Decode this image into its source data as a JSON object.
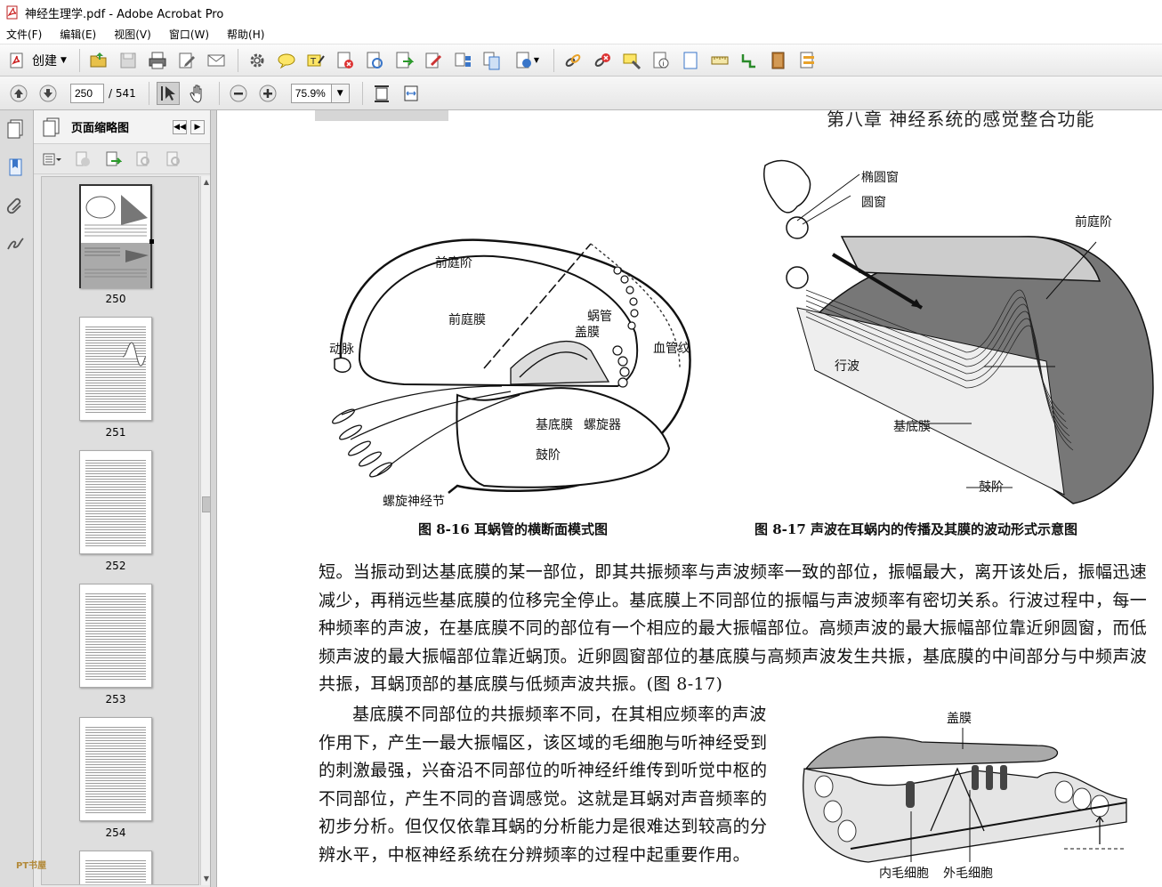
{
  "window": {
    "title": "神经生理学.pdf - Adobe Acrobat Pro"
  },
  "menu": [
    "文件(F)",
    "编辑(E)",
    "视图(V)",
    "窗口(W)",
    "帮助(H)"
  ],
  "toolbar": {
    "create_label": "创建"
  },
  "nav": {
    "page_value": "250",
    "page_total": "/ 541",
    "zoom_value": "75.9%"
  },
  "panel": {
    "title": "页面缩略图"
  },
  "thumbnails": [
    {
      "label": "250"
    },
    {
      "label": "251"
    },
    {
      "label": "252"
    },
    {
      "label": "253"
    },
    {
      "label": "254"
    }
  ],
  "document": {
    "running_header": "第八章  神经系统的感觉整合功能",
    "fig16": {
      "caption": "图 8-16   耳蜗管的横断面模式图",
      "labels": {
        "vestibuli": "前庭阶",
        "vest_membrane": "前庭膜",
        "cochlear_duct": "蜗管",
        "tectorial": "盖膜",
        "artery": "动脉",
        "stria": "血管纹",
        "basilar": "基底膜",
        "organ": "螺旋器",
        "tympani": "鼓阶",
        "ganglion": "螺旋神经节"
      }
    },
    "fig17": {
      "caption": "图 8-17   声波在耳蜗内的传播及其膜的波动形式示意图",
      "labels": {
        "oval": "椭圆窗",
        "round": "圆窗",
        "vestibuli": "前庭阶",
        "wave": "行波",
        "basilar": "基底膜",
        "tympani": "鼓阶"
      }
    },
    "paragraph1": "短。当振动到达基底膜的某一部位，即其共振频率与声波频率一致的部位，振幅最大，离开该处后，振幅迅速减少，再稍远些基底膜的位移完全停止。基底膜上不同部位的振幅与声波频率有密切关系。行波过程中，每一种频率的声波，在基底膜不同的部位有一个相应的最大振幅部位。高频声波的最大振幅部位靠近卵圆窗，而低频声波的最大振幅部位靠近蜗顶。近卵圆窗部位的基底膜与高频声波发生共振，基底膜的中间部分与中频声波共振，耳蜗顶部的基底膜与低频声波共振。(图 8-17)",
    "paragraph2": "基底膜不同部位的共振频率不同，在其相应频率的声波作用下，产生一最大振幅区，该区域的毛细胞与听神经受到的刺激最强，兴奋沿不同部位的听神经纤维传到听觉中枢的不同部位，产生不同的音调感觉。这就是耳蜗对声音频率的初步分析。但仅仅依靠耳蜗的分析能力是很难达到较高的分辨水平，中枢神经系统在分辨频率的过程中起重要作用。",
    "fig18": {
      "labels": {
        "tectorial": "盖膜",
        "inner": "内毛细胞",
        "outer": "外毛细胞"
      }
    }
  },
  "watermark": "PT书屋"
}
